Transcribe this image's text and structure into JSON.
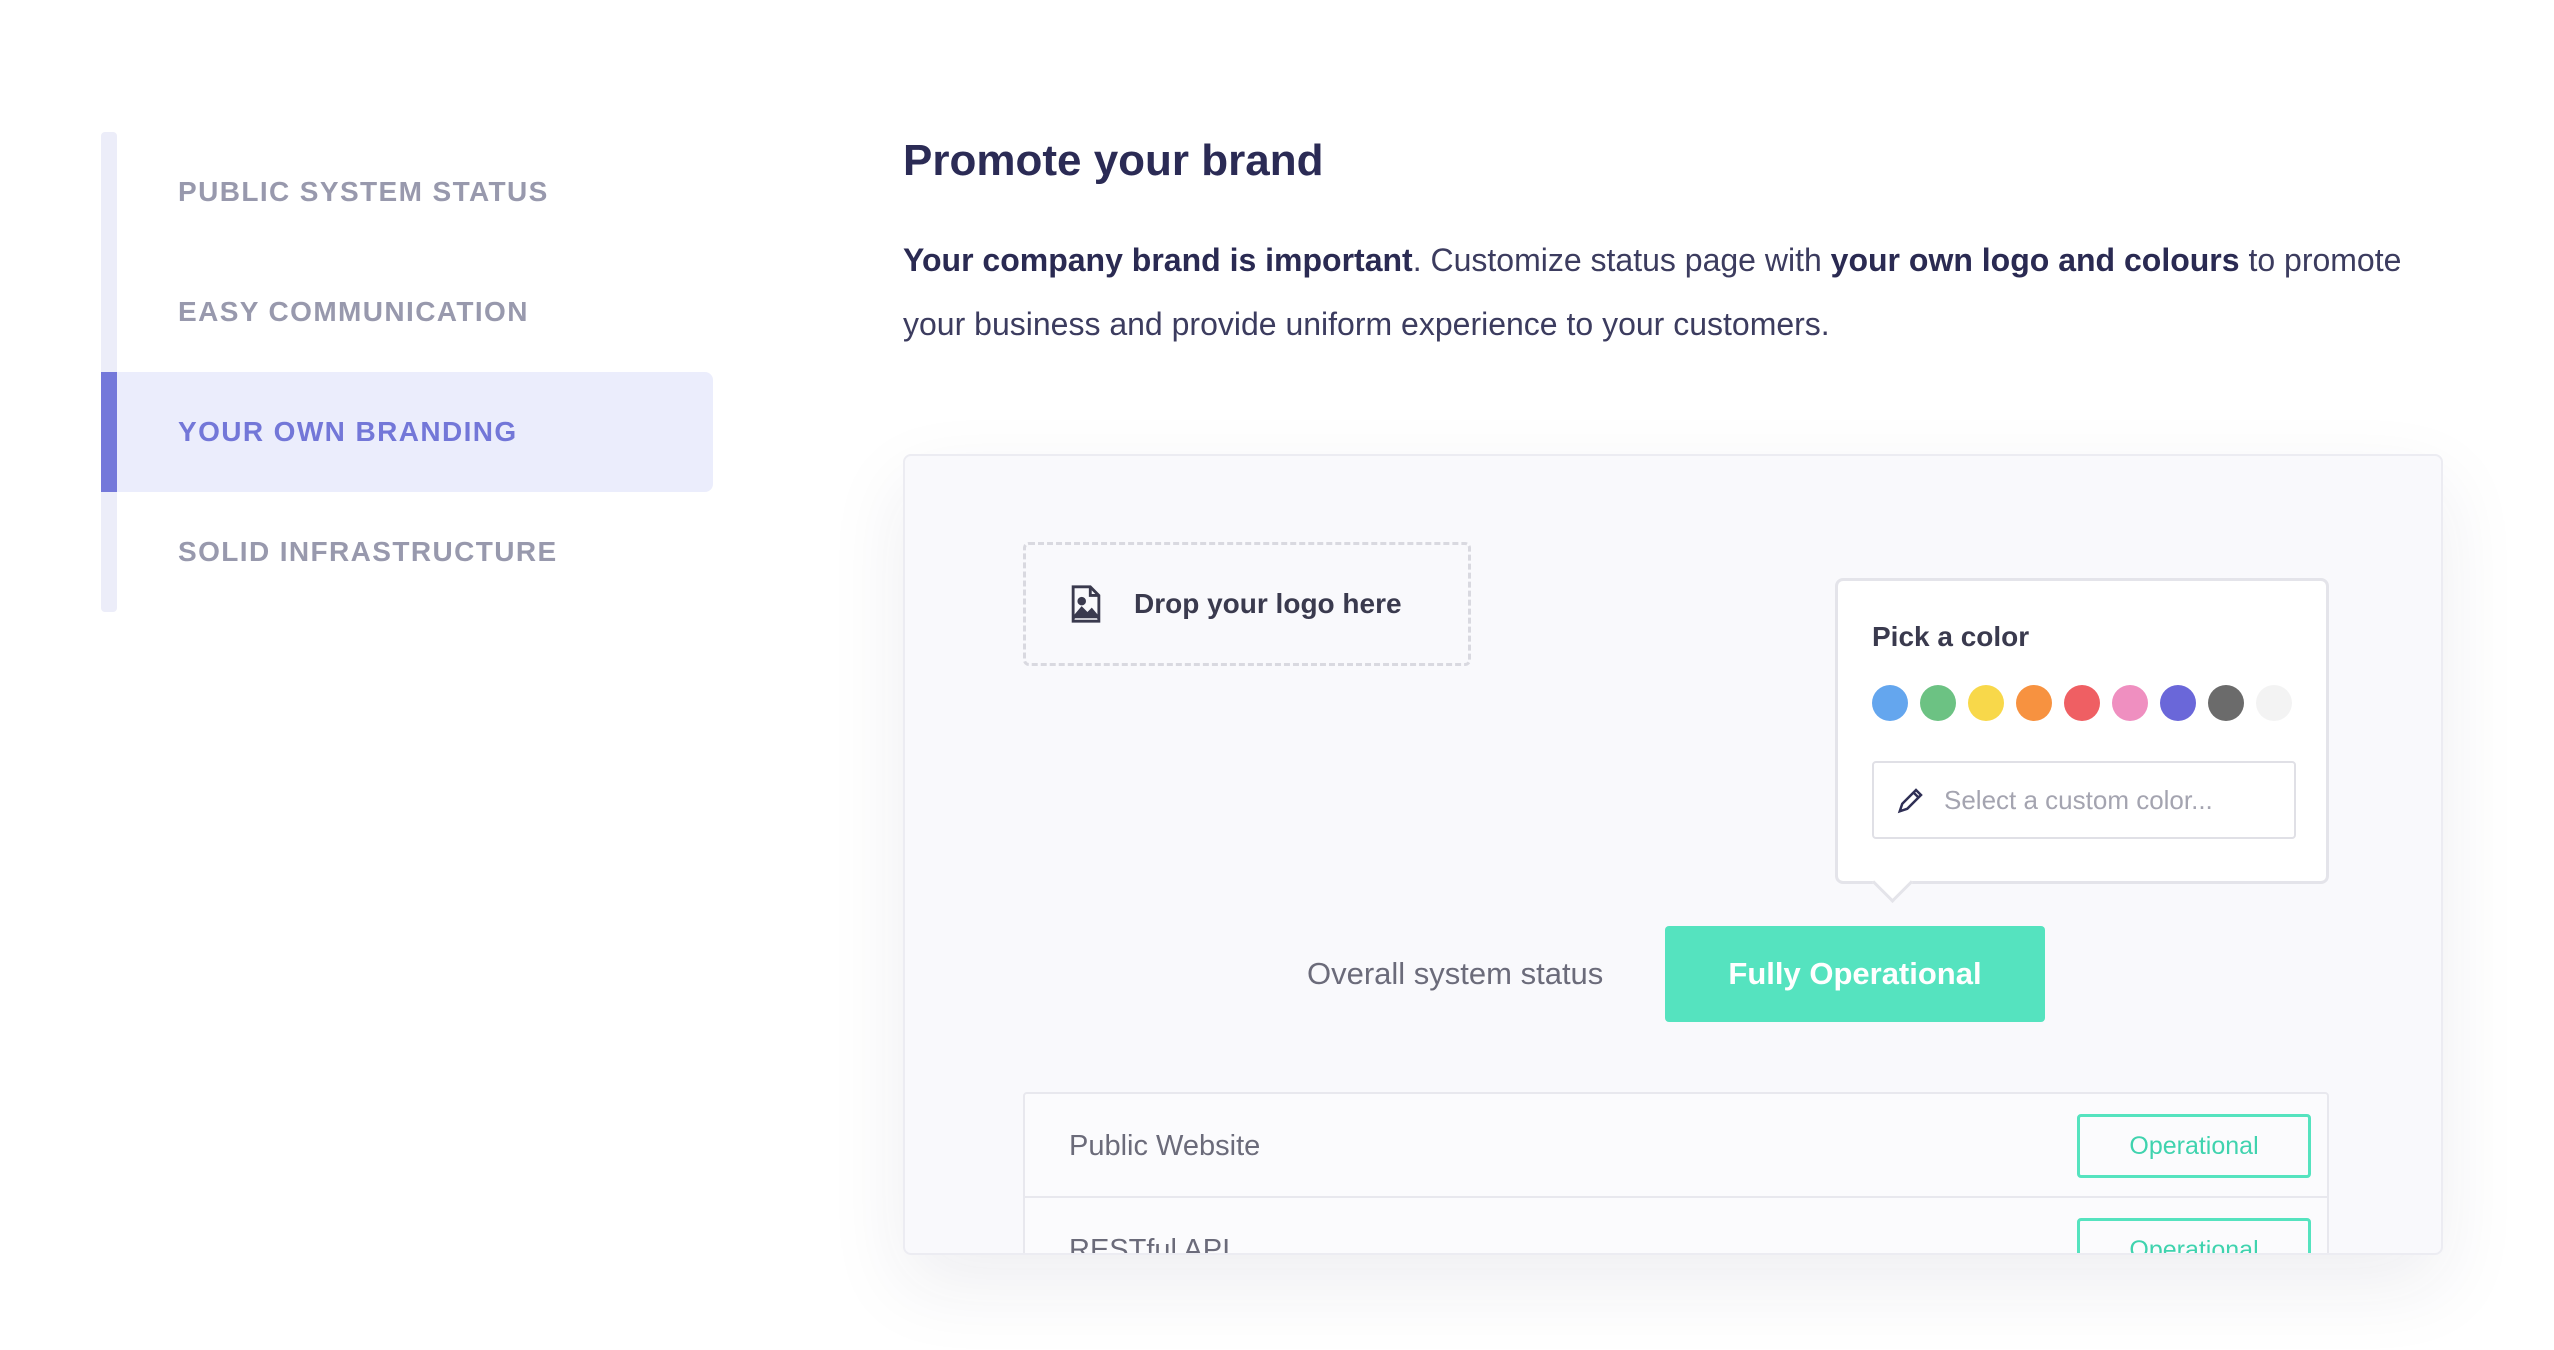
{
  "nav": {
    "items": [
      {
        "label": "PUBLIC SYSTEM STATUS",
        "active": false
      },
      {
        "label": "EASY COMMUNICATION",
        "active": false
      },
      {
        "label": "YOUR OWN BRANDING",
        "active": true
      },
      {
        "label": "SOLID INFRASTRUCTURE",
        "active": false
      }
    ]
  },
  "section": {
    "title": "Promote your brand",
    "desc_bold1": "Your company brand is important",
    "desc_text1": ". Customize status page with ",
    "desc_bold2": "your own logo and colours",
    "desc_text2": " to promote your business and provide uniform experience to your customers."
  },
  "demo": {
    "dropzone_label": "Drop your logo here",
    "picker": {
      "title": "Pick a color",
      "swatches": [
        "#64a6ee",
        "#6cc283",
        "#f8d84a",
        "#f79240",
        "#ef5f63",
        "#ef8fc0",
        "#6a67d9",
        "#6b6b6b",
        "#f3f3f3"
      ],
      "custom_placeholder": "Select a custom color..."
    },
    "overall_label": "Overall system status",
    "overall_status": "Fully Operational",
    "services": [
      {
        "name": "Public Website",
        "status": "Operational"
      },
      {
        "name": "RESTful API",
        "status": "Operational"
      }
    ]
  },
  "colors": {
    "accent": "#7478da",
    "operational": "#55e3bf"
  }
}
